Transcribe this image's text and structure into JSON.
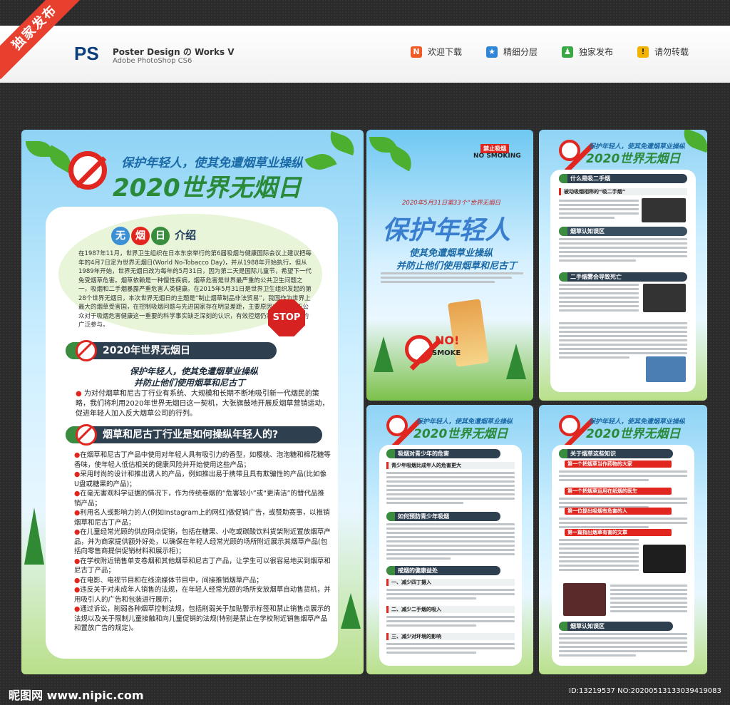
{
  "header": {
    "corner_badge": "独家发布",
    "logo": "PS",
    "title": "Poster Design の Works V",
    "subtitle": "Adobe PhotoShop CS6",
    "badges": [
      {
        "label": "欢迎下载",
        "icon": "N",
        "color": "#f15a24"
      },
      {
        "label": "精细分层",
        "icon": "★",
        "color": "#2f86d6"
      },
      {
        "label": "独家发布",
        "icon": "♟",
        "color": "#3aa843"
      },
      {
        "label": "请勿转载",
        "icon": "!",
        "color": "#f2b400"
      }
    ]
  },
  "main_poster": {
    "slogan": "保护年轻人，使其免遭烟草业操纵",
    "title": "2020世界无烟日",
    "intro_badges": [
      "无",
      "烟",
      "日"
    ],
    "intro_label": "介绍",
    "intro_text": "在1987年11月，世界卫生组织在日本东京举行的第6届吸烟与健康国际会议上建议把每年的4月7日定为世界无烟日(World No-Tobacco Day)，并从1988年开始执行。但从1989年开始，世界无烟日改为每年的5月31日，因为第二天是国际儿童节，希望下一代免受烟草危害。烟草依赖是一种慢性疾病，烟草危害是世界最严重的公共卫生问题之一，吸烟和二手烟暴露严重危害人类健康。在2015年5月31日是世界卫生组织发起的第28个世界无烟日，本次世界无烟日的主题是“制止烟草制品非法贸易”，我国作为世界上最大的烟草受害国，在控制吸烟问题与先进国家存在明显差距，主要原因之一都在于公众对于吸烟危害健康这一重要的科学事实缺乏深刻的认识，有效控烟仍需要社会各界的广泛参与。",
    "stop_label": "STOP",
    "section1": {
      "title": "2020年世界无烟日",
      "sub1": "保护年轻人，使其免遭烟草业操纵",
      "sub2": "并防止他们使用烟草和尼古丁",
      "body": "为对付烟草和尼古丁行业有系统、大规模和长期不断地吸引新一代烟民的策略，我们将利用2020年世界无烟日这一契机，大张旗鼓地开展反烟草营销运动，促进年轻人加入反大烟草公司的行列。"
    },
    "section2": {
      "title": "烟草和尼古丁行业是如何操纵年轻人的?",
      "bullets": [
        "在烟草和尼古丁产品中使用对年轻人具有吸引力的香型，如樱桃、泡泡糖和棉花糖等香味，使年轻人低估相关的健康风险并开始使用这些产品；",
        "采用时尚的设计和推出诱人的产品，例如推出易于携带且具有欺骗性的产品(比如像U盘或糖果的产品)；",
        "在毫无害观科学证据的情况下，作为传统卷烟的“危害较小”或“更清洁”的替代品推销产品；",
        "利用名人或影响力的人(例如Instagram上的网红)做促销广告，或赞助赛事，以推销烟草和尼古丁产品；",
        "在儿童经常光顾的供应网点促销，包括在糖果、小吃或碳酸饮料货架附近置放烟草产品，并为商家提供额外好处，以确保在年轻人经常光顾的场所附近展示其烟草产品(包括向零售商提供促销材料和展示柜)；",
        "在学校附近销售单支卷烟和其他烟草和尼古丁产品，让学生可以很容易地买到烟草和尼古丁产品；",
        "在电影、电视节目和在线流媒体节目中，间接推销烟草产品；",
        "违反关于对未成年人销售的法规，在年轻人经常光顾的场所安放烟草自动售货机，并用吸引人的广告和包装进行展示；",
        "通过诉讼，削弱各种烟草控制法规，包括削弱关于加贴警示标签和禁止销售点展示的法规以及关于限制儿童接触和向儿童促销的法规(特别是禁止在学校附近销售烟草产品和置放广告的规定)。"
      ]
    }
  },
  "cover_poster": {
    "top_badge": "禁止吸烟",
    "top_en": "NO SMOKING",
    "date_line": "2020年5月31日第33个“世界无烟日",
    "headline": "保护年轻人",
    "sub1": "使其免遭烟草业操纵",
    "sub2": "并防止他们使用烟草和尼古丁",
    "no_label": "NO!",
    "smoke_label": "SMOKE"
  },
  "poster_a": {
    "slogan": "保护年轻人，使其免遭烟草业操纵",
    "title": "2020世界无烟日",
    "sections": [
      "什么是吸二手烟",
      "烟草认知误区",
      "二手烟雾会导致死亡"
    ],
    "subs": [
      "被动吸烟相称的“吸二手烟”"
    ]
  },
  "poster_b": {
    "slogan": "保护年轻人，使其免遭烟草业操纵",
    "title": "2020世界无烟日",
    "sections": [
      "吸烟对青少年的危害",
      "如何预防青少年吸烟",
      "戒烟的健康益处"
    ],
    "subs": [
      "青少年吸烟比成年人的危害更大",
      "一、减少四丁摄入",
      "二、减少二手烟的吸入",
      "三、减少对环境的影响"
    ]
  },
  "poster_c": {
    "slogan": "保护年轻人，使其免遭烟草业操纵",
    "title": "2020世界无烟日",
    "sections": [
      "关于烟草这些知识",
      "烟草认知误区"
    ],
    "reds": [
      "第一个把烟草当作药物的大家",
      "第一个把烟草运用在纸烟的医生",
      "第一位提出吸烟有危害的人",
      "第一篇指出烟草有害的文章"
    ]
  },
  "footer": {
    "site": "昵图网 www.nipic.com",
    "id": "ID:13219537 NO:20200513133039419083"
  }
}
